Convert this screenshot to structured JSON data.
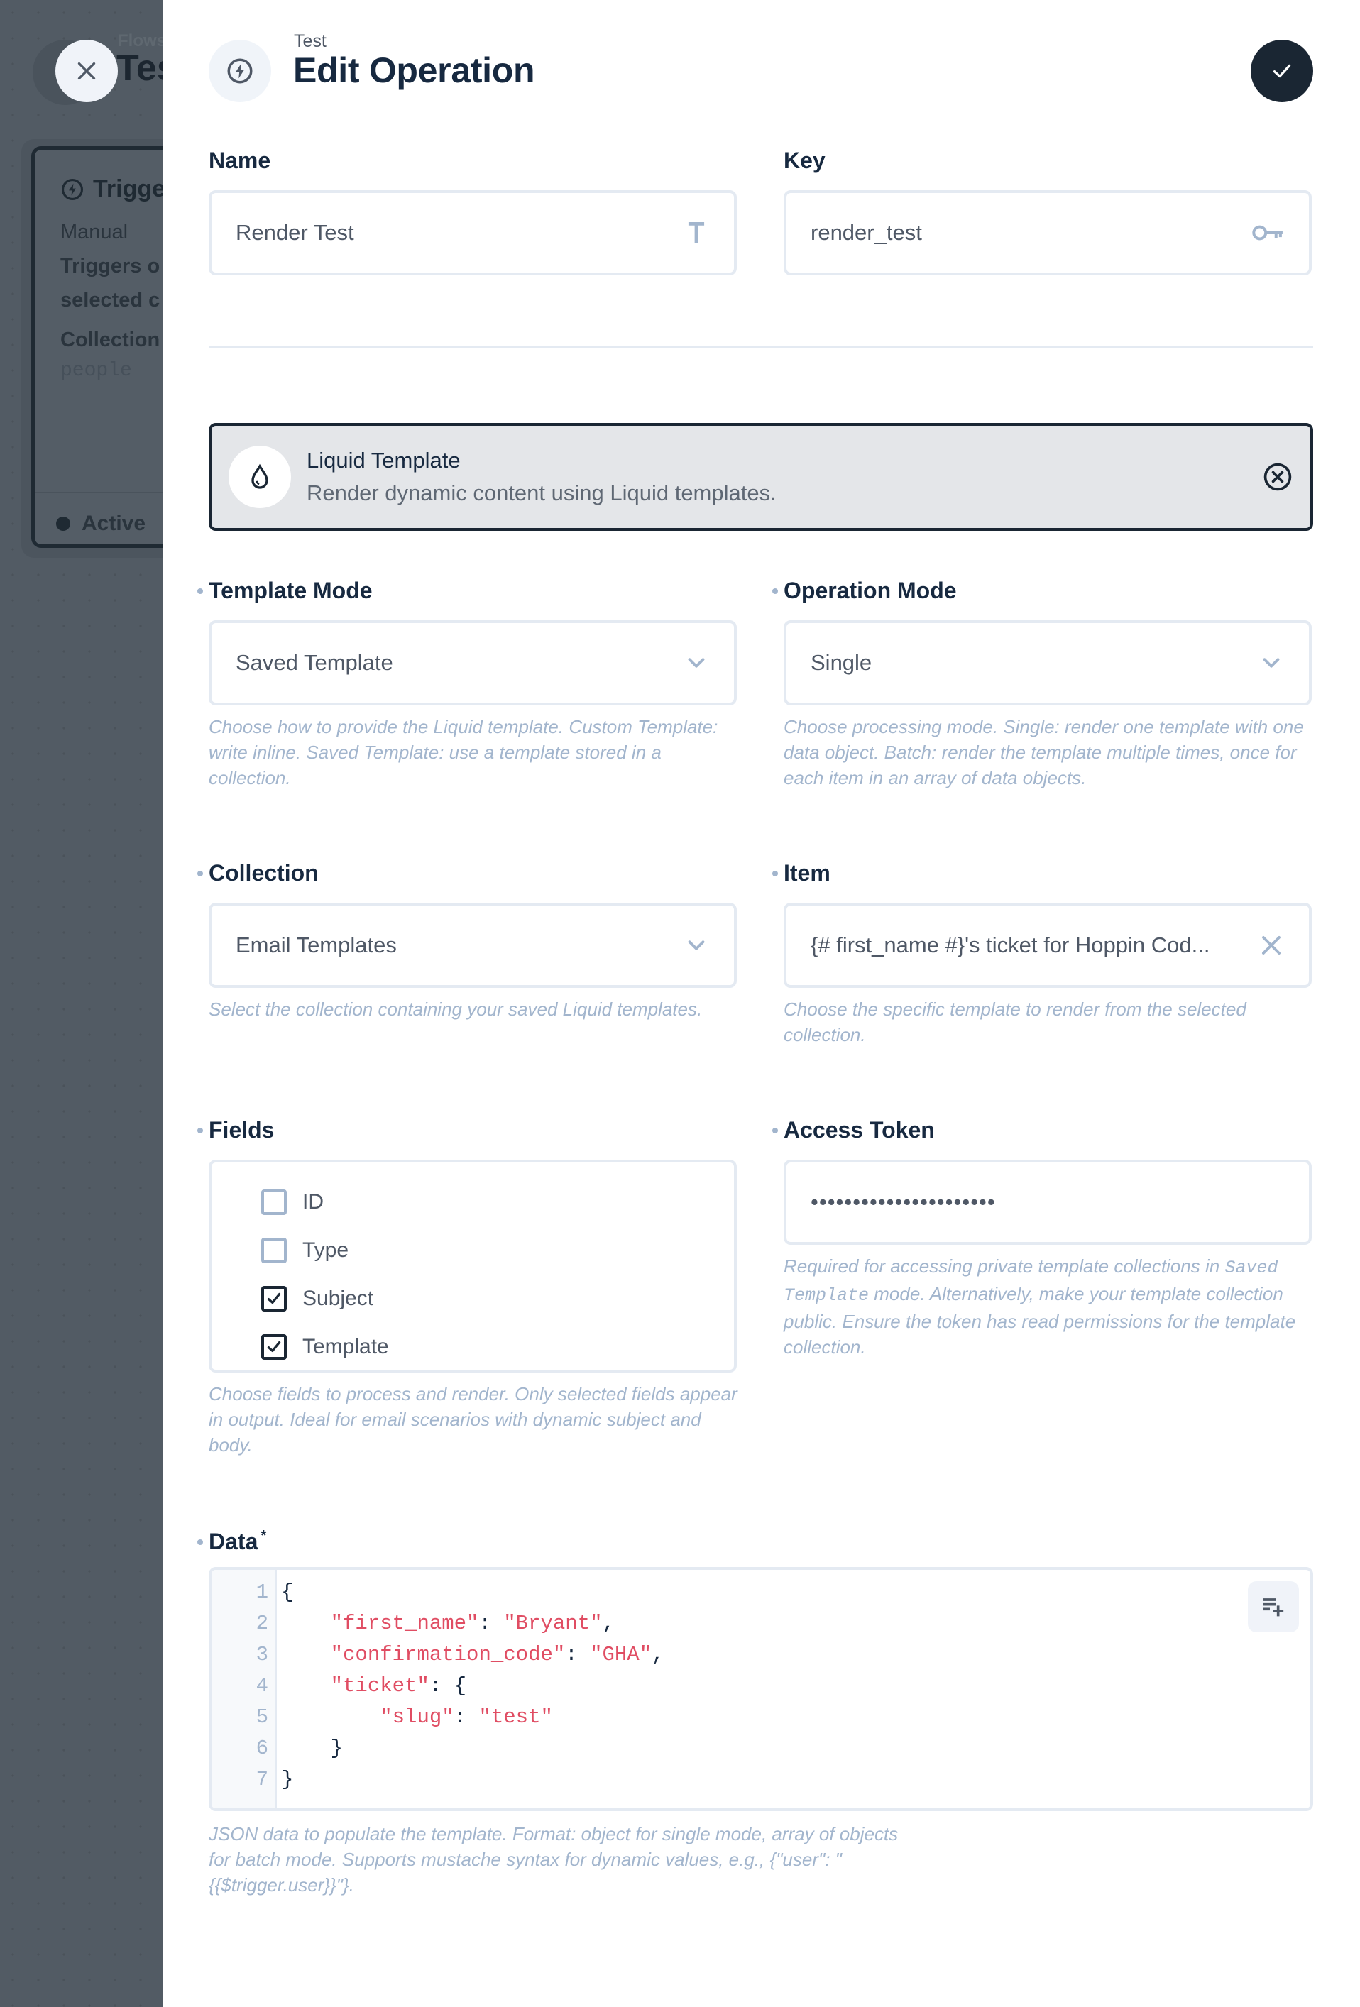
{
  "background": {
    "breadcrumb": "Flows",
    "title": "Test",
    "trigger_card": {
      "title": "Trigger",
      "type": "Manual",
      "description_line1": "Triggers o",
      "description_line2": "selected c",
      "collections_label": "Collection",
      "collections_value": "people",
      "status": "Active"
    }
  },
  "drawer": {
    "subtitle": "Test",
    "title": "Edit Operation",
    "close_icon": "close-icon",
    "save_icon": "check-icon",
    "header_icon": "bolt-icon"
  },
  "form": {
    "name": {
      "label": "Name",
      "value": "Render Test",
      "icon": "text-type-icon"
    },
    "key": {
      "label": "Key",
      "value": "render_test",
      "icon": "key-icon"
    },
    "operation": {
      "title": "Liquid Template",
      "description": "Render dynamic content using Liquid templates.",
      "icon": "water-drop-icon",
      "remove_icon": "close-circle-icon"
    },
    "template_mode": {
      "label": "Template Mode",
      "value": "Saved Template",
      "note": "Choose how to provide the Liquid template. Custom Template: write inline. Saved Template: use a template stored in a collection."
    },
    "operation_mode": {
      "label": "Operation Mode",
      "value": "Single",
      "note": "Choose processing mode. Single: render one template with one data object. Batch: render the template multiple times, once for each item in an array of data objects."
    },
    "collection": {
      "label": "Collection",
      "value": "Email Templates",
      "note": "Select the collection containing your saved Liquid templates."
    },
    "item": {
      "label": "Item",
      "value": "{# first_name #}'s ticket for Hoppin Cod...",
      "note": "Choose the specific template to render from the selected collection."
    },
    "fields": {
      "label": "Fields",
      "options": [
        {
          "label": "ID",
          "checked": false
        },
        {
          "label": "Type",
          "checked": false
        },
        {
          "label": "Subject",
          "checked": true
        },
        {
          "label": "Template",
          "checked": true
        }
      ],
      "note": "Choose fields to process and render. Only selected fields appear in output. Ideal for email scenarios with dynamic subject and body."
    },
    "access_token": {
      "label": "Access Token",
      "value": "••••••••••••••••••••••",
      "note_before": "Required for accessing private template collections in ",
      "note_code": "Saved Template",
      "note_after": " mode. Alternatively, make your template collection public. Ensure the token has read permissions for the template collection."
    },
    "data": {
      "label": "Data",
      "required_mark": "*",
      "lines": [
        {
          "n": "1",
          "indent": "",
          "key": "",
          "sep": "",
          "value": "",
          "tail": "{"
        },
        {
          "n": "2",
          "indent": "    ",
          "key": "\"first_name\"",
          "sep": ": ",
          "value": "\"Bryant\"",
          "tail": ","
        },
        {
          "n": "3",
          "indent": "    ",
          "key": "\"confirmation_code\"",
          "sep": ": ",
          "value": "\"GHA\"",
          "tail": ","
        },
        {
          "n": "4",
          "indent": "    ",
          "key": "\"ticket\"",
          "sep": ": ",
          "value": "",
          "tail": "{"
        },
        {
          "n": "5",
          "indent": "        ",
          "key": "\"slug\"",
          "sep": ": ",
          "value": "\"test\"",
          "tail": ""
        },
        {
          "n": "6",
          "indent": "    ",
          "key": "",
          "sep": "",
          "value": "",
          "tail": "}"
        },
        {
          "n": "7",
          "indent": "",
          "key": "",
          "sep": "",
          "value": "",
          "tail": "}"
        }
      ],
      "insert_icon": "playlist-add-icon",
      "note": "JSON data to populate the template. Format: object for single mode, array of objects for batch mode. Supports mustache syntax for dynamic values, e.g., {\"user\": \"{{$trigger.user}}\"}."
    }
  }
}
